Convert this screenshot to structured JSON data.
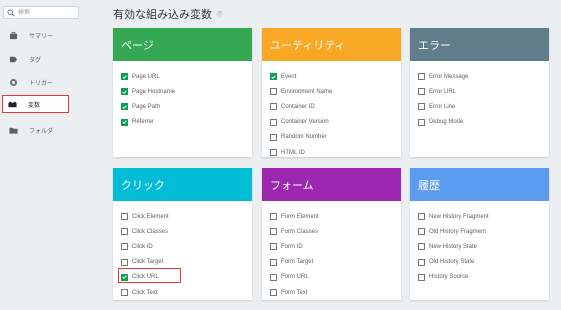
{
  "search": {
    "placeholder": "検索"
  },
  "nav": [
    {
      "label": "サマリー",
      "icon": "briefcase-icon"
    },
    {
      "label": "タグ",
      "icon": "tag-icon"
    },
    {
      "label": "トリガー",
      "icon": "trigger-icon"
    },
    {
      "label": "変数",
      "icon": "variables-icon",
      "active": true
    },
    {
      "label": "フォルダ",
      "icon": "folder-icon"
    }
  ],
  "main": {
    "title": "有効な組み込み変数",
    "info": "?"
  },
  "cards": [
    {
      "title": "ページ",
      "color": "#34a853",
      "items": [
        {
          "label": "Page URL",
          "checked": true
        },
        {
          "label": "Page Hostname",
          "checked": true
        },
        {
          "label": "Page Path",
          "checked": true
        },
        {
          "label": "Referrer",
          "checked": true
        }
      ]
    },
    {
      "title": "ユーティリティ",
      "color": "#f9a825",
      "items": [
        {
          "label": "Event",
          "checked": true
        },
        {
          "label": "Environment Name",
          "checked": false
        },
        {
          "label": "Container ID",
          "checked": false
        },
        {
          "label": "Container Version",
          "checked": false
        },
        {
          "label": "Random Number",
          "checked": false
        },
        {
          "label": "HTML ID",
          "checked": false
        }
      ]
    },
    {
      "title": "エラー",
      "color": "#607d8b",
      "items": [
        {
          "label": "Error Message",
          "checked": false
        },
        {
          "label": "Error URL",
          "checked": false
        },
        {
          "label": "Error Line",
          "checked": false
        },
        {
          "label": "Debug Mode",
          "checked": false
        }
      ]
    },
    {
      "title": "クリック",
      "color": "#00bcd4",
      "items": [
        {
          "label": "Click Element",
          "checked": false
        },
        {
          "label": "Click Classes",
          "checked": false
        },
        {
          "label": "Click ID",
          "checked": false
        },
        {
          "label": "Click Target",
          "checked": false
        },
        {
          "label": "Click URL",
          "checked": true,
          "highlighted": true
        },
        {
          "label": "Click Text",
          "checked": false
        }
      ]
    },
    {
      "title": "フォーム",
      "color": "#9c27b0",
      "items": [
        {
          "label": "Form Element",
          "checked": false
        },
        {
          "label": "Form Classes",
          "checked": false
        },
        {
          "label": "Form ID",
          "checked": false
        },
        {
          "label": "Form Target",
          "checked": false
        },
        {
          "label": "Form URL",
          "checked": false
        },
        {
          "label": "Form Text",
          "checked": false
        }
      ]
    },
    {
      "title": "履歴",
      "color": "#5b9bf0",
      "items": [
        {
          "label": "New History Fragment",
          "checked": false
        },
        {
          "label": "Old History Fragment",
          "checked": false
        },
        {
          "label": "New History State",
          "checked": false
        },
        {
          "label": "Old History State",
          "checked": false
        },
        {
          "label": "History Source",
          "checked": false
        }
      ]
    }
  ]
}
